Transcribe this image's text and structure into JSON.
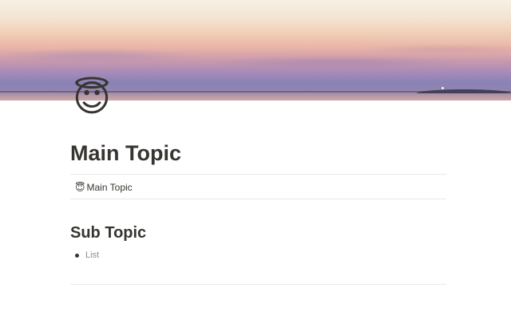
{
  "page": {
    "icon": "😇",
    "icon_name": "smiling-face-with-halo-icon",
    "title": "Main Topic"
  },
  "link_block": {
    "icon": "😇",
    "label": "Main Topic"
  },
  "section": {
    "heading": "Sub Topic",
    "items": [
      {
        "label": "List"
      }
    ]
  },
  "colors": {
    "text": "#37352f",
    "muted": "#8f8e8a",
    "divider": "#e9e9e7"
  }
}
